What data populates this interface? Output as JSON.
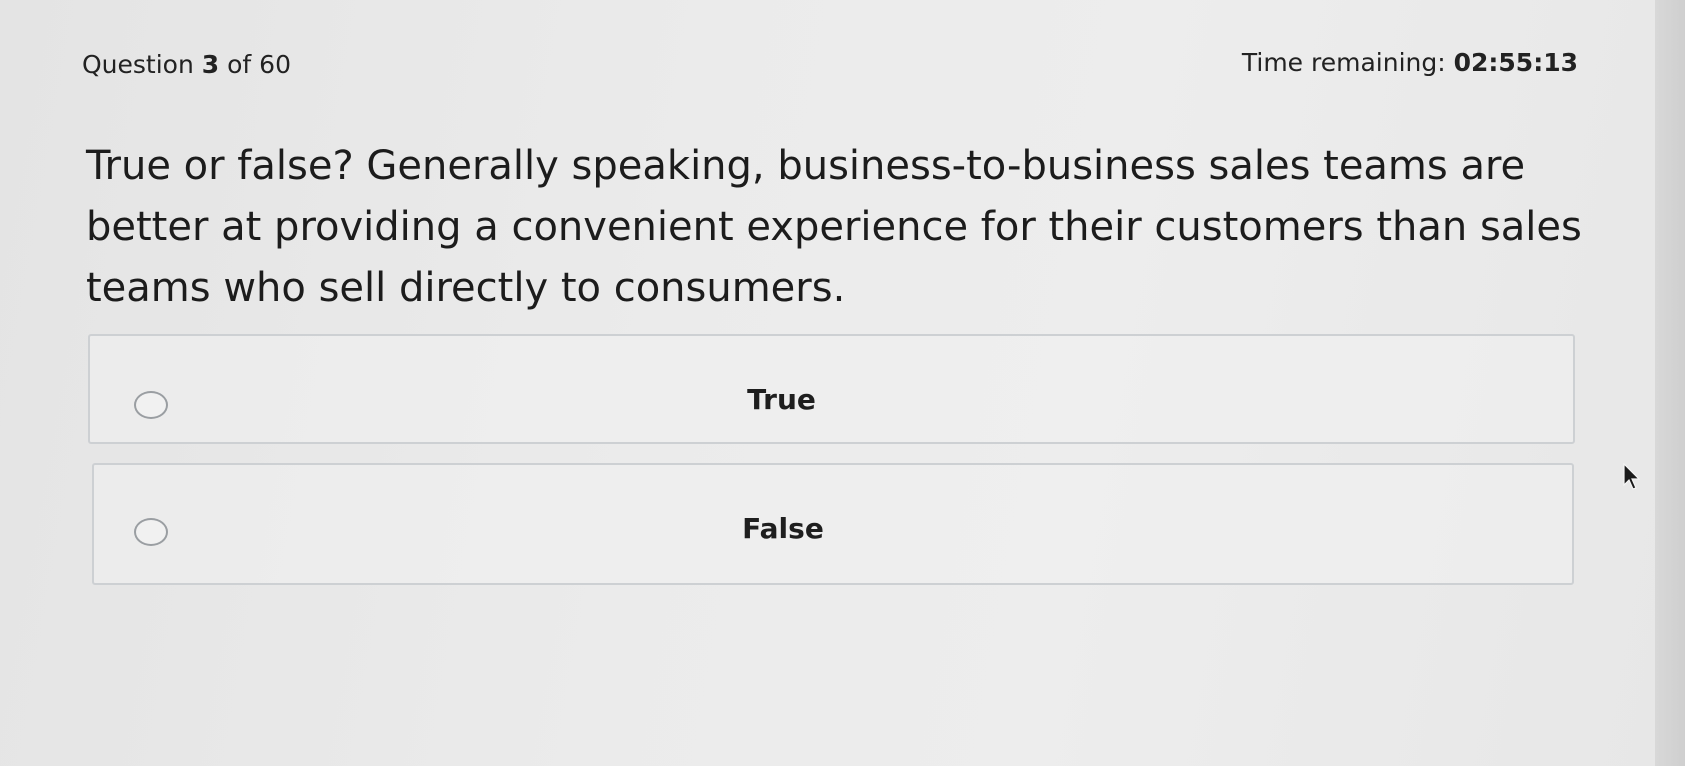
{
  "header": {
    "question_word": "Question",
    "question_number": "3",
    "question_of": "of 60",
    "timer_label": "Time remaining:",
    "timer_value": "02:55:13"
  },
  "question": {
    "text": "True or false? Generally speaking, business-to-business sales teams are better at providing a convenient experience for their customers than sales teams who sell directly to consumers."
  },
  "options": [
    {
      "label": "True",
      "selected": false
    },
    {
      "label": "False",
      "selected": false
    }
  ],
  "colors": {
    "background": "#ebebeb",
    "option_border": "#cdd0d3",
    "radio_border": "#9a9ea2",
    "text": "#1e1e1e"
  }
}
